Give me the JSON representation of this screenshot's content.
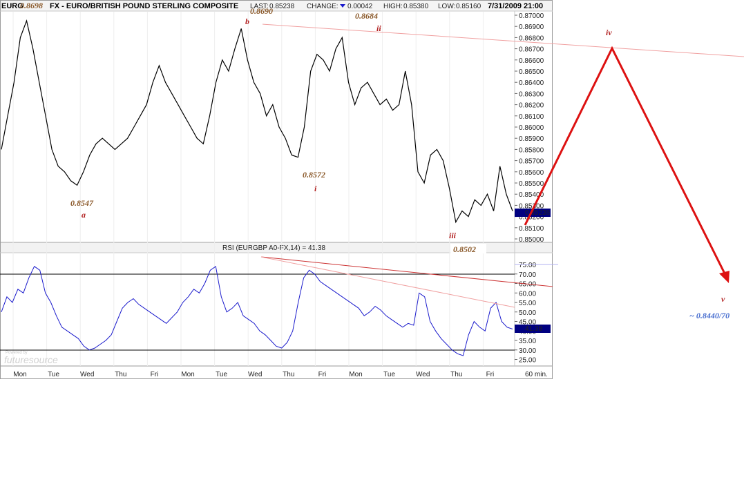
{
  "header": {
    "symbol": "EURG",
    "title": "FX - EURO/BRITISH POUND STERLING COMPOSITE",
    "last_label": "LAST:",
    "last": "0.85238",
    "change_label": "CHANGE:",
    "change": "0.00042",
    "high_label": "HIGH:",
    "high": "0.85380",
    "low_label": "LOW:",
    "low": "0.85160",
    "datetime": "7/31/2009 21:00"
  },
  "price_axis": {
    "ticks": [
      "0.87000",
      "0.86900",
      "0.86800",
      "0.86700",
      "0.86600",
      "0.86500",
      "0.86400",
      "0.86300",
      "0.86200",
      "0.86100",
      "0.86000",
      "0.85900",
      "0.85800",
      "0.85700",
      "0.85600",
      "0.85500",
      "0.85400",
      "0.85300",
      "0.85200",
      "0.85100",
      "0.85000"
    ],
    "current": "0.85238"
  },
  "rsi": {
    "title": "RSI (EURGBP A0-FX,14) = 41.38",
    "ticks": [
      "75.00",
      "70.00",
      "65.00",
      "60.00",
      "55.00",
      "50.00",
      "45.00",
      "40.00",
      "35.00",
      "30.00",
      "25.00"
    ],
    "current": "41.38"
  },
  "x_axis": {
    "days": [
      "Mon",
      "Tue",
      "Wed",
      "Thu",
      "Fri",
      "Mon",
      "Tue",
      "Wed",
      "Thu",
      "Fri",
      "Mon",
      "Tue",
      "Wed",
      "Thu",
      "Fri"
    ],
    "interval": "60 min."
  },
  "watermark": {
    "small": "Powered by",
    "brand": "futuresource"
  },
  "annotations": {
    "p_0_8698": "0.8698",
    "p_0_8690": "0.8690",
    "p_0_8684": "0.8684",
    "p_0_8572": "0.8572",
    "p_0_8547": "0.8547",
    "p_0_8502": "0.8502",
    "w_a": "a",
    "w_b": "b",
    "w_i": "i",
    "w_ii": "ii",
    "w_iii": "iii",
    "w_iv": "iv",
    "w_v": "v",
    "target": "~ 0.8440/70"
  },
  "colors": {
    "price_line": "#000000",
    "rsi_line": "#1a1acc",
    "wave_label": "#b22222",
    "price_label": "#8b5a2b",
    "projection": "#dd1111",
    "trendline": "#f0a0a0",
    "target": "#4a70d0"
  },
  "chart_data": [
    {
      "type": "line",
      "title": "FX - EURO/BRITISH POUND STERLING COMPOSITE",
      "x_unit": "60 min.",
      "x_categories": [
        "Mon",
        "Tue",
        "Wed",
        "Thu",
        "Fri",
        "Mon",
        "Tue",
        "Wed",
        "Thu",
        "Fri",
        "Mon",
        "Tue",
        "Wed",
        "Thu",
        "Fri"
      ],
      "ylim": [
        0.85,
        0.8705
      ],
      "series": [
        {
          "values": [
            0.858,
            0.861,
            0.864,
            0.868,
            0.8695,
            0.867,
            0.864,
            0.861,
            0.858,
            0.8565,
            0.856,
            0.8552,
            0.8548,
            0.856,
            0.8575,
            0.8585,
            0.859,
            0.8585,
            0.858,
            0.8585,
            0.859,
            0.86,
            0.861,
            0.862,
            0.864,
            0.8655,
            0.864,
            0.863,
            0.862,
            0.861,
            0.86,
            0.859,
            0.8585,
            0.861,
            0.864,
            0.866,
            0.865,
            0.867,
            0.8688,
            0.866,
            0.864,
            0.863,
            0.861,
            0.862,
            0.86,
            0.859,
            0.8575,
            0.8573,
            0.86,
            0.865,
            0.8665,
            0.866,
            0.865,
            0.867,
            0.868,
            0.864,
            0.862,
            0.8635,
            0.864,
            0.863,
            0.862,
            0.8625,
            0.8615,
            0.862,
            0.865,
            0.862,
            0.856,
            0.855,
            0.8575,
            0.858,
            0.857,
            0.8545,
            0.8515,
            0.8525,
            0.852,
            0.8535,
            0.853,
            0.854,
            0.8525,
            0.8565,
            0.854,
            0.8525
          ]
        }
      ],
      "annotations": [
        {
          "label": "0.8698",
          "wave": ""
        },
        {
          "label": "0.8547",
          "wave": "a"
        },
        {
          "label": "0.8690",
          "wave": "b"
        },
        {
          "label": "0.8572",
          "wave": "i"
        },
        {
          "label": "0.8684",
          "wave": "ii"
        },
        {
          "label": "0.8502",
          "wave": "iii"
        },
        {
          "label": "",
          "wave": "iv"
        },
        {
          "label": "~ 0.8440/70",
          "wave": "v"
        }
      ]
    },
    {
      "type": "line",
      "title": "RSI (EURGBP A0-FX,14) = 41.38",
      "ylim": [
        23,
        78
      ],
      "reference_lines": [
        70,
        30
      ],
      "series": [
        {
          "values": [
            50,
            58,
            55,
            62,
            60,
            68,
            74,
            72,
            60,
            55,
            48,
            42,
            40,
            38,
            36,
            32,
            30,
            31,
            33,
            35,
            38,
            45,
            52,
            55,
            57,
            54,
            52,
            50,
            48,
            46,
            44,
            47,
            50,
            55,
            58,
            62,
            60,
            65,
            72,
            74,
            58,
            50,
            52,
            55,
            48,
            46,
            44,
            40,
            38,
            35,
            32,
            31,
            34,
            40,
            55,
            68,
            72,
            70,
            66,
            64,
            62,
            60,
            58,
            56,
            54,
            52,
            48,
            50,
            53,
            51,
            48,
            46,
            44,
            42,
            44,
            43,
            60,
            58,
            45,
            40,
            36,
            33,
            30,
            28,
            27,
            38,
            45,
            42,
            40,
            52,
            55,
            45,
            42,
            41
          ]
        }
      ]
    }
  ]
}
